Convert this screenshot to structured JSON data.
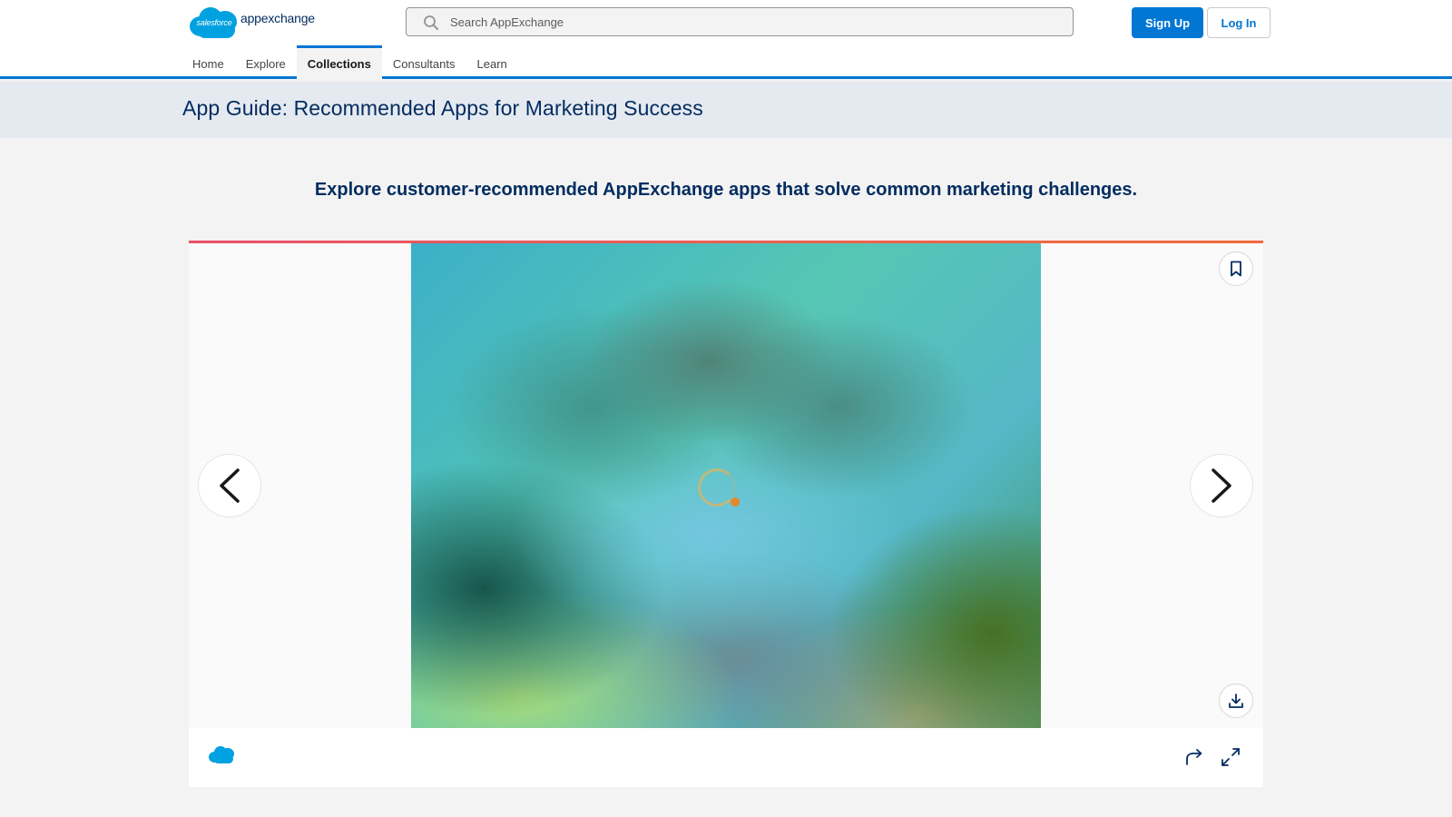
{
  "header": {
    "logo_small_text": "salesforce",
    "logo_word": "appexchange",
    "search": {
      "placeholder": "Search AppExchange",
      "value": ""
    },
    "signup_label": "Sign Up",
    "login_label": "Log In"
  },
  "nav": {
    "items": [
      {
        "label": "Home"
      },
      {
        "label": "Explore"
      },
      {
        "label": "Collections"
      },
      {
        "label": "Consultants"
      },
      {
        "label": "Learn"
      }
    ],
    "active": "Collections"
  },
  "page": {
    "title": "App Guide: Recommended Apps for Marketing Success",
    "intro": "Explore customer-recommended AppExchange apps that solve common marketing challenges."
  },
  "icons": {
    "search": "search-icon",
    "bookmark": "bookmark-icon",
    "download": "download-icon",
    "prev": "chevron-left-icon",
    "next": "chevron-right-icon",
    "share": "share-icon",
    "expand": "expand-icon",
    "loading": "loading-spinner-icon"
  },
  "colors": {
    "brand_blue": "#0176d3",
    "title_navy": "#032d60",
    "band_bg": "#e5e9f0",
    "accent_start": "#e8516a",
    "accent_end": "#f26b3c"
  }
}
